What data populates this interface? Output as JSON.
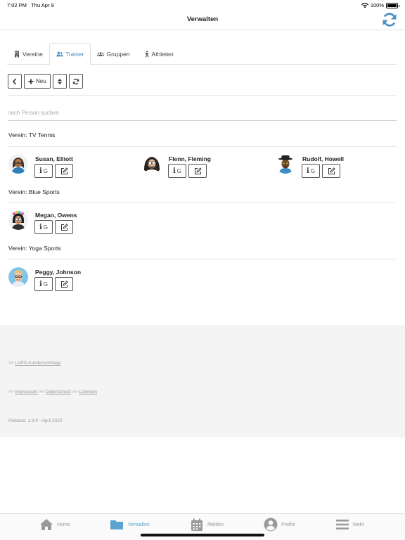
{
  "status": {
    "time": "7:02 PM",
    "date": "Thu Apr 9",
    "battery": "100%",
    "battery_level": 1.0
  },
  "header": {
    "title": "Verwalten"
  },
  "tabs": [
    {
      "label": "Vereine",
      "icon": "building-icon",
      "active": false
    },
    {
      "label": "Trainer",
      "icon": "users-icon",
      "active": true
    },
    {
      "label": "Gruppen",
      "icon": "group-icon",
      "active": false
    },
    {
      "label": "Athleten",
      "icon": "running-icon",
      "active": false
    }
  ],
  "toolbar": {
    "new_label": "Neu"
  },
  "search": {
    "placeholder": "nach Person suchen",
    "value": ""
  },
  "clubs": [
    {
      "label": "Verein: TV Tennis",
      "persons": [
        "Susan, Elliott",
        "Flenn, Fleming",
        "Rudolf, Howell"
      ]
    },
    {
      "label": "Verein: Blue Sports",
      "persons": [
        "Megan, Owens"
      ]
    },
    {
      "label": "Verein: Yoga Sports",
      "persons": [
        "Peggy, Johnson"
      ]
    }
  ],
  "person_button": {
    "group_letter": "G"
  },
  "footer": {
    "survey_prefix": ">> ",
    "survey": "LAPS-Kundenumfrage",
    "links_prefix": ">> ",
    "impressum": "Impressum",
    "sep1": " >> ",
    "datenschutz": "Datenschutz",
    "sep2": " >> ",
    "lizenzen": "Lizenzen",
    "release": "Release: 1.9.9 - April 2020"
  },
  "tabbar": [
    {
      "label": "Home",
      "icon": "home-icon",
      "active": false
    },
    {
      "label": "Verwalten",
      "icon": "folder-icon",
      "active": true
    },
    {
      "label": "Melden",
      "icon": "calendar-icon",
      "active": false
    },
    {
      "label": "Profile",
      "icon": "user-circle-icon",
      "active": false
    },
    {
      "label": "Mehr",
      "icon": "menu-icon",
      "active": false
    }
  ],
  "colors": {
    "accent": "#4a90c2",
    "tab_active": "#5da3cf",
    "footer_bg": "#f4f4f4"
  }
}
